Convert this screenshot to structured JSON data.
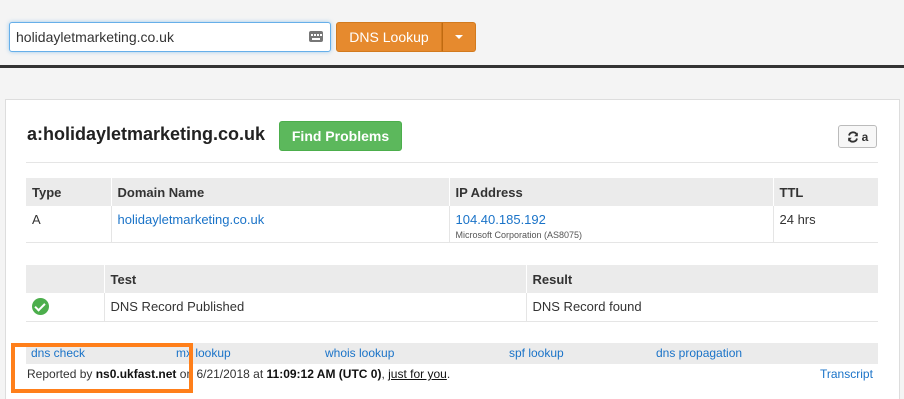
{
  "search": {
    "value": "holidayletmarketing.co.uk",
    "lookup_label": "DNS Lookup"
  },
  "result": {
    "heading": "a:holidayletmarketing.co.uk",
    "find_problems_label": "Find Problems",
    "refresh_label": "a"
  },
  "records_table": {
    "headers": [
      "Type",
      "Domain Name",
      "IP Address",
      "TTL"
    ],
    "rows": [
      {
        "type": "A",
        "domain": "holidayletmarketing.co.uk",
        "ip": "104.40.185.192",
        "ip_owner": "Microsoft Corporation (AS8075)",
        "ttl": "24 hrs"
      }
    ]
  },
  "test_table": {
    "headers": [
      "",
      "Test",
      "Result"
    ],
    "rows": [
      {
        "status": "pass",
        "test": "DNS Record Published",
        "result": "DNS Record found"
      }
    ]
  },
  "links": [
    "dns check",
    "mx lookup",
    "whois lookup",
    "spf lookup",
    "dns propagation"
  ],
  "footer": {
    "reported_by_prefix": "Reported by",
    "server": "ns0.ukfast.net",
    "on_text": "on 6/21/2018 at",
    "time": "11:09:12 AM (UTC 0)",
    "comma": ",",
    "just_for_you": "just for you",
    "period": ".",
    "transcript": "Transcript"
  },
  "colors": {
    "accent": "#e68a2e",
    "success": "#5cb85c",
    "link": "#1a73c8",
    "highlight": "#ff7f1a"
  }
}
